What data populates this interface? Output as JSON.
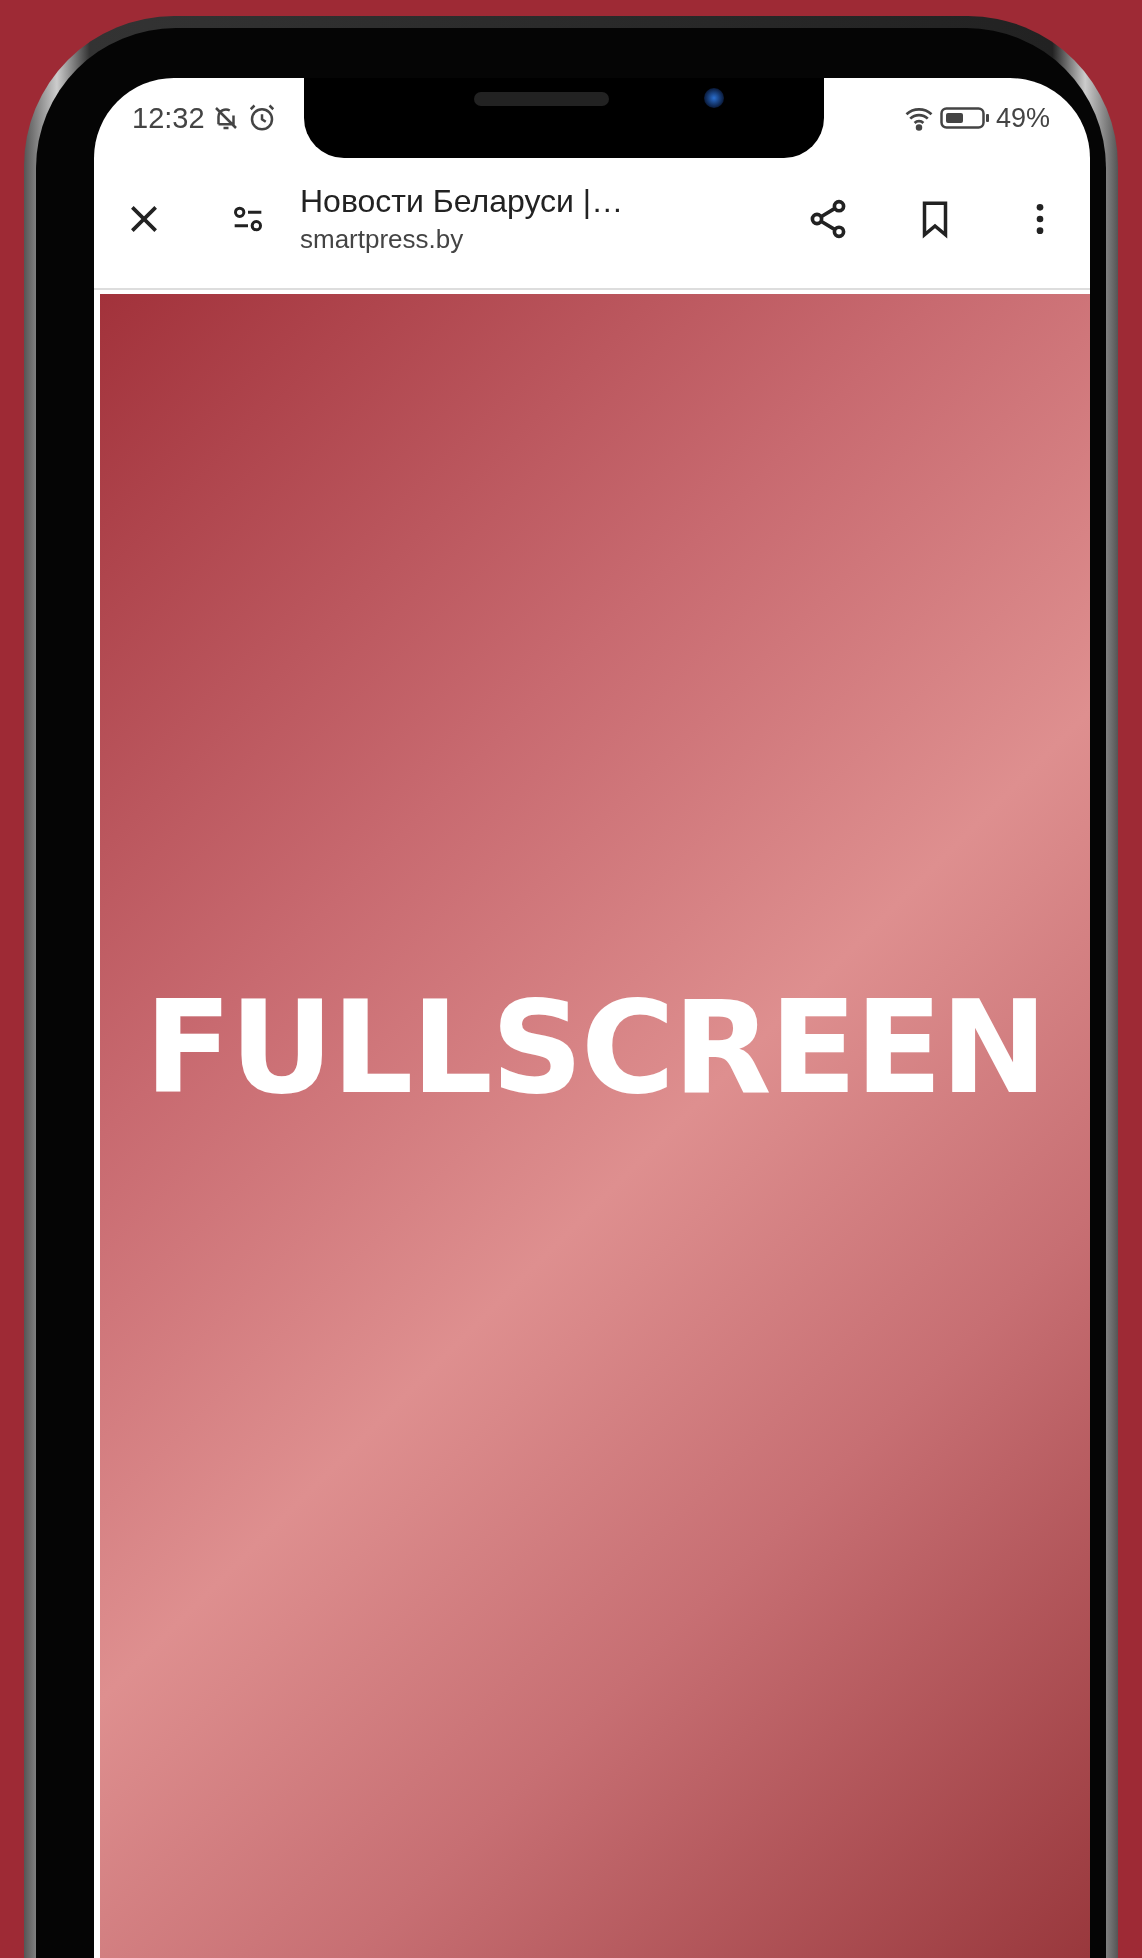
{
  "status_bar": {
    "time": "12:32",
    "battery": "49%"
  },
  "browser_bar": {
    "title": "Новости Беларуси |…",
    "url": "smartpress.by"
  },
  "ad": {
    "text": "FULLSCREEN"
  }
}
